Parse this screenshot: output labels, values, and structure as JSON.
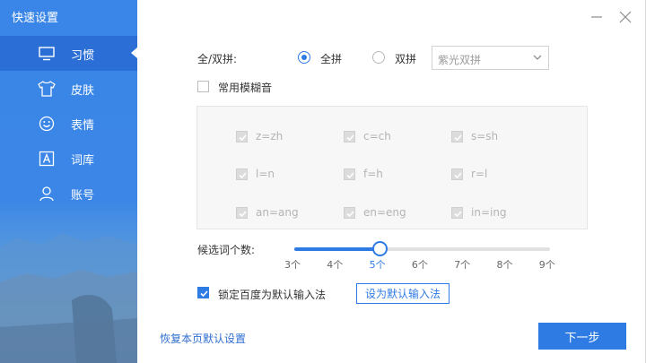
{
  "sidebar": {
    "title": "快速设置",
    "items": [
      {
        "label": "习惯",
        "icon": "monitor-icon",
        "active": true
      },
      {
        "label": "皮肤",
        "icon": "tshirt-icon",
        "active": false
      },
      {
        "label": "表情",
        "icon": "smiley-icon",
        "active": false
      },
      {
        "label": "词库",
        "icon": "letter-a-icon",
        "active": false
      },
      {
        "label": "账号",
        "icon": "user-icon",
        "active": false
      }
    ]
  },
  "pinyin": {
    "label": "全/双拼:",
    "options": [
      "全拼",
      "双拼"
    ],
    "selected": "全拼",
    "scheme_value": "紫光双拼"
  },
  "fuzzy": {
    "label": "常用模糊音",
    "enabled": false,
    "pairs": [
      "z=zh",
      "c=ch",
      "s=sh",
      "l=n",
      "f=h",
      "r=l",
      "an=ang",
      "en=eng",
      "in=ing"
    ]
  },
  "candidates": {
    "label": "候选词个数:",
    "ticks": [
      "3个",
      "4个",
      "5个",
      "6个",
      "7个",
      "8个",
      "9个"
    ],
    "selected_index": 2
  },
  "lock": {
    "label": "锁定百度为默认输入法",
    "checked": true,
    "set_default_label": "设为默认输入法"
  },
  "footer": {
    "restore_label": "恢复本页默认设置",
    "next_label": "下一步"
  },
  "colors": {
    "accent": "#2f7be4",
    "sidebar": "#3a86e8",
    "active": "#2b6fd6"
  }
}
